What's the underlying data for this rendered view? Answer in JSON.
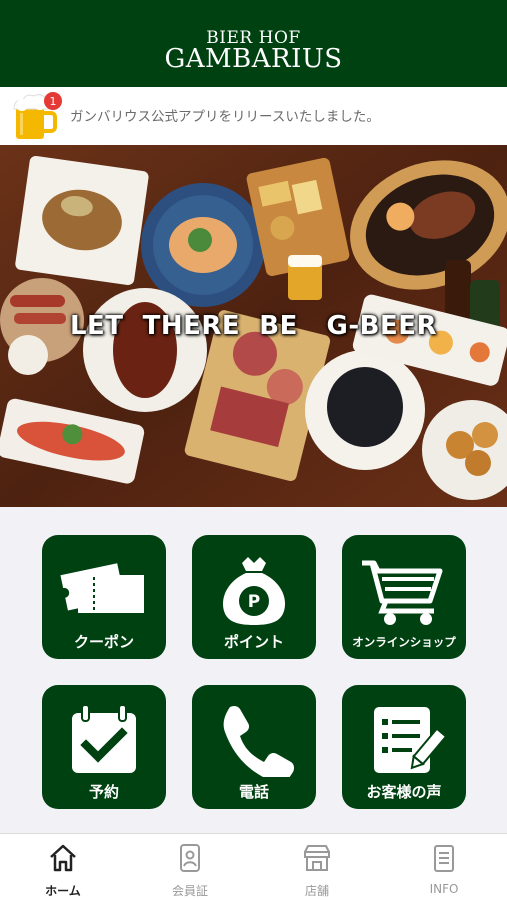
{
  "header": {
    "logo_line1": "BIER HOF",
    "logo_line2": "GAMBARIUS"
  },
  "notice": {
    "badge_count": "1",
    "text": "ガンバリウス公式アプリをリリースいたしました。"
  },
  "hero": {
    "caption": "LET  THERE  BE   G-BEER"
  },
  "menu": {
    "coupon": "クーポン",
    "point": "ポイント",
    "point_symbol": "P",
    "shop": "オンラインショップ",
    "reserve": "予約",
    "phone": "電話",
    "voice": "お客様の声"
  },
  "tabs": {
    "home": "ホーム",
    "member": "会員証",
    "stores": "店舗",
    "info": "INFO"
  },
  "colors": {
    "brand_green": "#004111",
    "badge_red": "#e53935"
  }
}
